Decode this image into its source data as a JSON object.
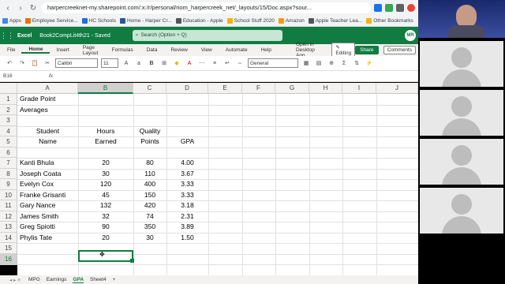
{
  "browser": {
    "url": "harpercreeknet-my.sharepoint.com/:x:/r/personal/riom_harpercreek_net/_layouts/15/Doc.aspx?sour...",
    "bookmarks": [
      "Apps",
      "Employee Service...",
      "HC Schools",
      "Home - Harper Cr...",
      "Education - Apple",
      "School Stuff 2020",
      "Amazon",
      "Apple Teacher Lea...",
      "Other Bookmarks"
    ]
  },
  "excel": {
    "app_name": "Excel",
    "book_name": "Book2CompLit4th21 - Saved",
    "search_placeholder": "Search (Option + Q)",
    "user_initials": "MR",
    "menu": [
      "File",
      "Home",
      "Insert",
      "Page Layout",
      "Formulas",
      "Data",
      "Review",
      "View",
      "Automate",
      "Help"
    ],
    "open_desktop": "Open in Desktop App",
    "editing": "Editing",
    "share": "Share",
    "comments": "Comments",
    "font_name": "Calibri",
    "font_size": "11",
    "number_format": "General",
    "name_box": "B16",
    "fx": "fx"
  },
  "columns": [
    "A",
    "B",
    "C",
    "D",
    "E",
    "F",
    "G",
    "H",
    "I",
    "J"
  ],
  "rows": [
    "1",
    "2",
    "3",
    "4",
    "5",
    "6",
    "7",
    "8",
    "9",
    "10",
    "11",
    "12",
    "13",
    "14",
    "15",
    "16"
  ],
  "sheet": {
    "a1": "Grade Point",
    "a2": "Averages",
    "headers": {
      "student_top": "Student",
      "student_bottom": "Name",
      "hours_top": "Hours",
      "hours_bottom": "Earned",
      "quality_top": "Quality",
      "quality_bottom": "Points",
      "gpa": "GPA"
    },
    "students": [
      {
        "name": "Kanti Bhula",
        "hours": "20",
        "points": "80",
        "gpa": "4.00"
      },
      {
        "name": "Joseph Coata",
        "hours": "30",
        "points": "110",
        "gpa": "3.67"
      },
      {
        "name": "Evelyn Cox",
        "hours": "120",
        "points": "400",
        "gpa": "3.33"
      },
      {
        "name": "Franke Grisanti",
        "hours": "45",
        "points": "150",
        "gpa": "3.33"
      },
      {
        "name": "Gary Nance",
        "hours": "132",
        "points": "420",
        "gpa": "3.18"
      },
      {
        "name": "James Smith",
        "hours": "32",
        "points": "74",
        "gpa": "2.31"
      },
      {
        "name": "Greg Spiotti",
        "hours": "90",
        "points": "350",
        "gpa": "3.89"
      },
      {
        "name": "Phylis Tate",
        "hours": "20",
        "points": "30",
        "gpa": "1.50"
      }
    ]
  },
  "tabs": [
    "MPG",
    "Earnings",
    "GPA",
    "Sheet4",
    "+"
  ],
  "active_tab": "GPA",
  "colors": {
    "excel_green": "#107c41",
    "video_bg": "#000000"
  }
}
